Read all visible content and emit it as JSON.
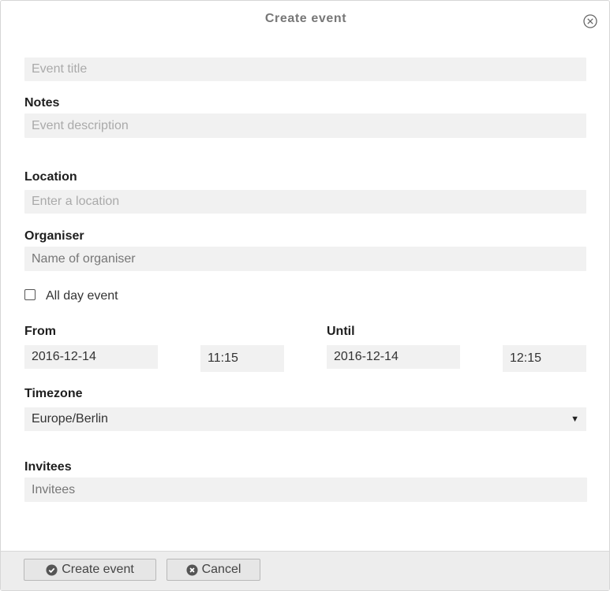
{
  "dialog": {
    "title": "Create event",
    "close_icon": "close-circle-icon"
  },
  "form": {
    "title_placeholder": "Event title",
    "notes_label": "Notes",
    "notes_placeholder": "Event description",
    "location_label": "Location",
    "location_placeholder": "Enter a location",
    "organiser_label": "Organiser",
    "organiser_placeholder": "Name of organiser",
    "all_day_label": "All day event",
    "all_day_checked": false,
    "from_label": "From",
    "from_date": "2016-12-14",
    "from_time": "11:15",
    "until_label": "Until",
    "until_date": "2016-12-14",
    "until_time": "12:15",
    "timezone_label": "Timezone",
    "timezone_value": "Europe/Berlin",
    "timezone_arrow_icon": "dropdown-triangle-icon",
    "invitees_label": "Invitees",
    "invitees_placeholder": "Invitees"
  },
  "footer": {
    "create_label": "Create event",
    "create_icon": "check-circle-icon",
    "cancel_label": "Cancel",
    "cancel_icon": "x-circle-icon"
  }
}
